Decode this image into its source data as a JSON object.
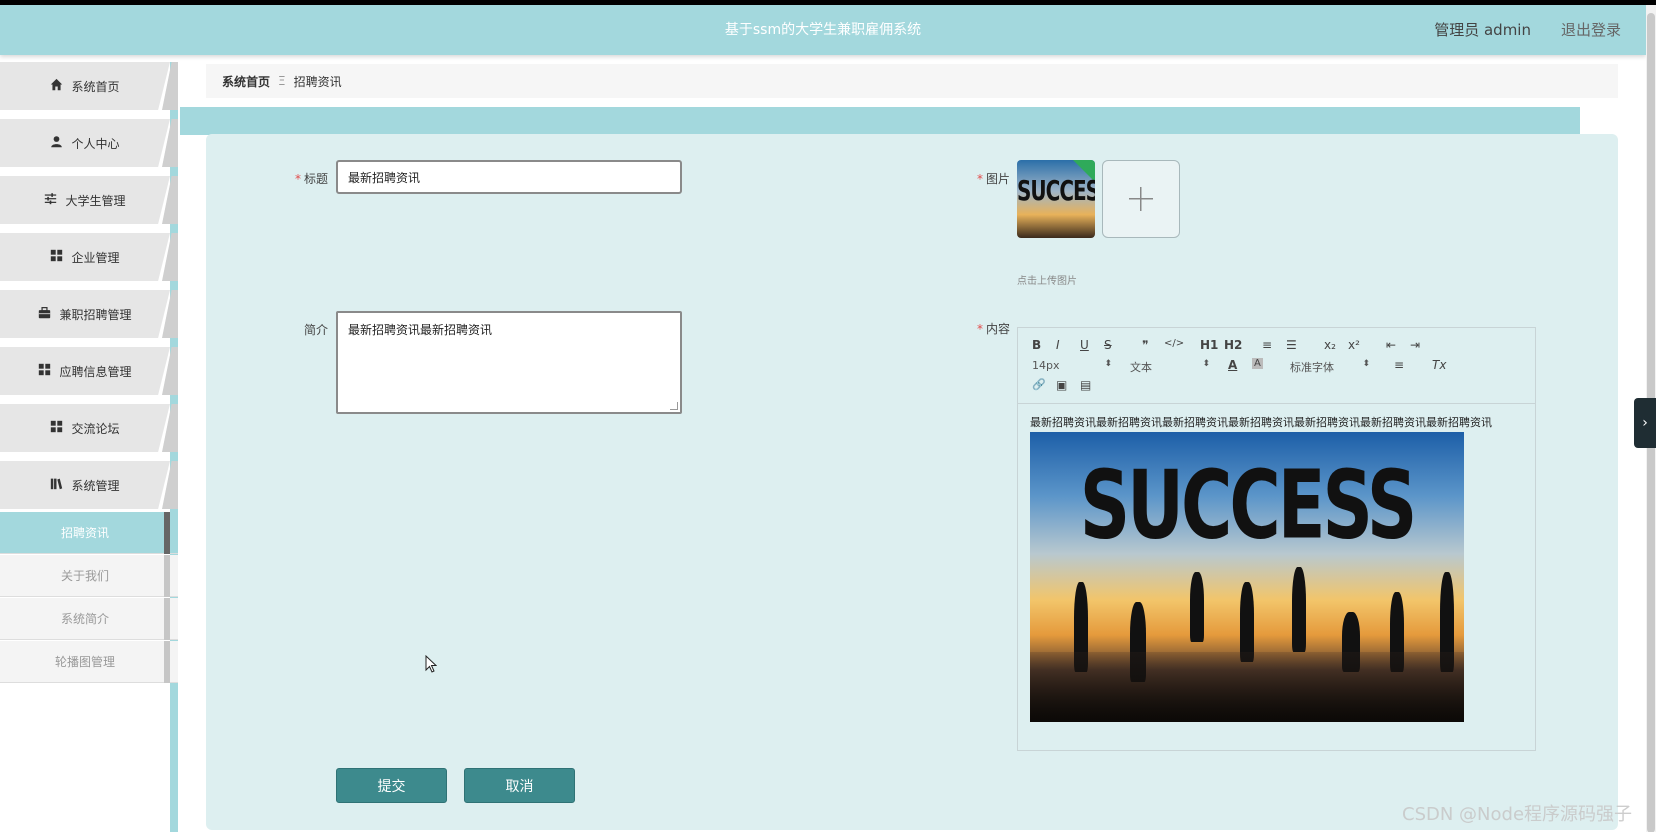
{
  "header": {
    "title": "基于ssm的大学生兼职雇佣系统",
    "user": "管理员 admin",
    "logout": "退出登录"
  },
  "sidebar": {
    "items": [
      {
        "label": "系统首页",
        "icon": "home-icon"
      },
      {
        "label": "个人中心",
        "icon": "person-icon"
      },
      {
        "label": "大学生管理",
        "icon": "sliders-icon"
      },
      {
        "label": "企业管理",
        "icon": "grid-icon"
      },
      {
        "label": "兼职招聘管理",
        "icon": "briefcase-icon"
      },
      {
        "label": "应聘信息管理",
        "icon": "grid-icon"
      },
      {
        "label": "交流论坛",
        "icon": "grid-icon"
      },
      {
        "label": "系统管理",
        "icon": "library-icon"
      }
    ],
    "subitems": [
      {
        "label": "招聘资讯",
        "active": true
      },
      {
        "label": "关于我们",
        "active": false
      },
      {
        "label": "系统简介",
        "active": false
      },
      {
        "label": "轮播图管理",
        "active": false
      }
    ]
  },
  "breadcrumb": {
    "home": "系统首页",
    "separator": "Ξ",
    "current": "招聘资讯"
  },
  "form": {
    "title_label": "标题",
    "title_value": "最新招聘资讯",
    "summary_label": "简介",
    "summary_value": "最新招聘资讯最新招聘资讯",
    "image_label": "图片",
    "image_text": "SUCCESS",
    "upload_hint": "点击上传图片",
    "content_label": "内容",
    "content_text": "最新招聘资讯最新招聘资讯最新招聘资讯最新招聘资讯最新招聘资讯最新招聘资讯最新招聘资讯",
    "content_image_text": "SUCCESS",
    "required_mark": "*",
    "submit": "提交",
    "cancel": "取消"
  },
  "editor_toolbar": {
    "bold": "B",
    "italic": "I",
    "underline": "U",
    "strike": "S",
    "quote": "❞",
    "code": "</>",
    "h1": "H1",
    "h2": "H2",
    "ordered_list": "≡",
    "bullet_list": "☰",
    "subscript": "x₂",
    "superscript": "x²",
    "outdent": "⇤",
    "indent": "⇥",
    "font_size": "14px",
    "text_type": "文本",
    "font_color": "A",
    "bg_color": "A",
    "font_family": "标准字体",
    "align": "≡",
    "clear_format": "Tx",
    "link": "🔗",
    "image": "▣",
    "video": "▤"
  },
  "side_tab": "›",
  "watermark": "CSDN @Node程序源码强子",
  "colors": {
    "header": "#a3d8dd",
    "panel": "#ddeff0",
    "button": "#3d8a8d",
    "required": "#e24c4c"
  }
}
